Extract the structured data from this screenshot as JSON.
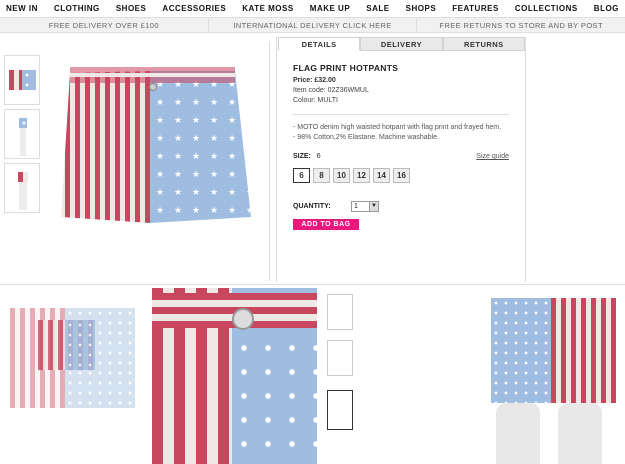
{
  "nav": {
    "items": [
      "NEW IN",
      "CLOTHING",
      "SHOES",
      "ACCESSORIES",
      "KATE MOSS",
      "MAKE UP",
      "SALE",
      "SHOPS",
      "FEATURES",
      "COLLECTIONS",
      "BLOG"
    ]
  },
  "promo": {
    "items": [
      "FREE DELIVERY OVER £100",
      "INTERNATIONAL DELIVERY CLICK HERE",
      "FREE RETURNS TO STORE AND BY POST"
    ]
  },
  "tabs": [
    "DETAILS",
    "DELIVERY",
    "RETURNS"
  ],
  "product": {
    "title": "FLAG PRINT HOTPANTS",
    "price": "Price: £32.00",
    "item_code": "Item code: 02Z36WMUL",
    "colour": "Colour: MULTI",
    "desc1": "- MOTO denim high waisted hotpant with flag print and frayed hem.",
    "desc2": "- 98% Cotton,2% Elastane. Machine washable.",
    "size_label": "SIZE:",
    "size_value": "6",
    "size_guide": "Size guide",
    "sizes": [
      "6",
      "8",
      "10",
      "12",
      "14",
      "16"
    ],
    "qty_label": "QUANTITY:",
    "qty_value": "1",
    "add_to_bag": "ADD TO BAG"
  },
  "colors": {
    "accent": "#e8187f",
    "stripe_red": "#c8465e",
    "denim_blue": "#9ebde0"
  }
}
